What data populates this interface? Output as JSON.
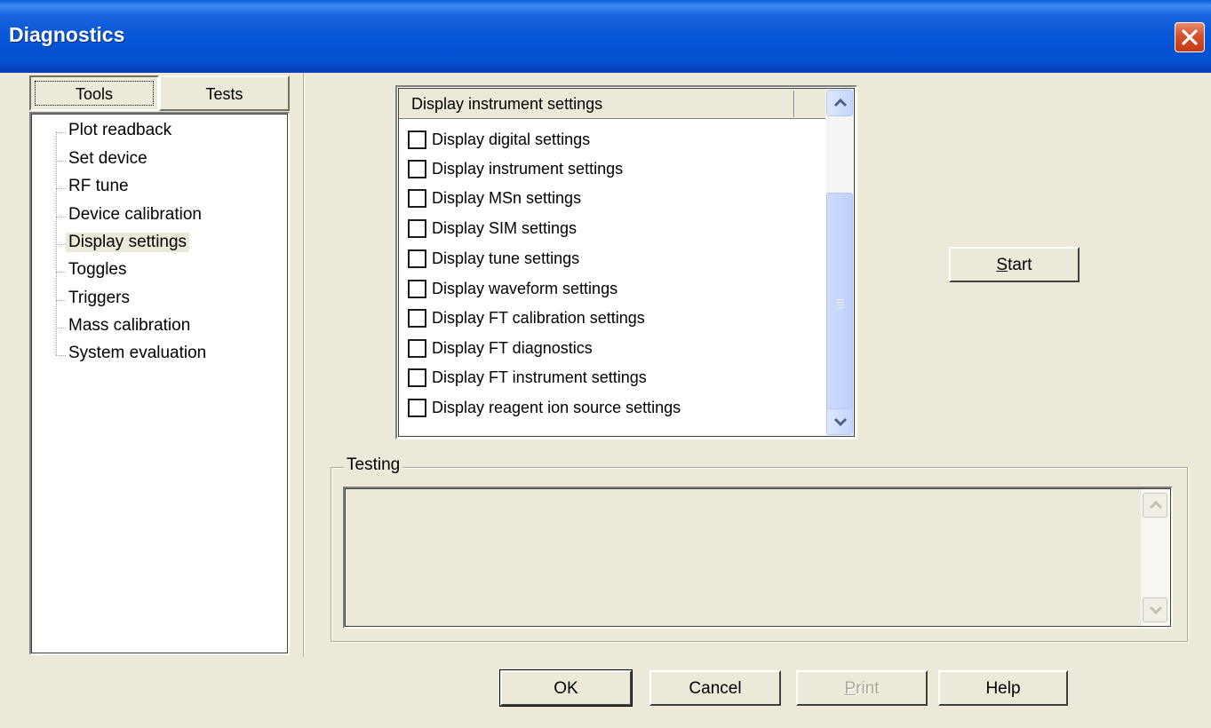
{
  "window": {
    "title": "Diagnostics"
  },
  "tabs": [
    {
      "label": "Tools",
      "active": true
    },
    {
      "label": "Tests",
      "active": false
    }
  ],
  "tree": {
    "items": [
      "Plot readback",
      "Set device",
      "RF tune",
      "Device calibration",
      "Display settings",
      "Toggles",
      "Triggers",
      "Mass calibration",
      "System evaluation"
    ],
    "selected": "Display settings"
  },
  "settings_list": {
    "header": "Display instrument settings",
    "items": [
      {
        "label": "Display digital settings",
        "checked": false
      },
      {
        "label": "Display instrument settings",
        "checked": false
      },
      {
        "label": "Display MSn settings",
        "checked": false
      },
      {
        "label": "Display SIM settings",
        "checked": false
      },
      {
        "label": "Display tune settings",
        "checked": false
      },
      {
        "label": "Display waveform settings",
        "checked": false
      },
      {
        "label": "Display FT calibration settings",
        "checked": false
      },
      {
        "label": "Display FT diagnostics",
        "checked": false
      },
      {
        "label": "Display FT instrument settings",
        "checked": false
      },
      {
        "label": "Display reagent ion source settings",
        "checked": false
      }
    ]
  },
  "start_button": {
    "label_mnemonic": "S",
    "label_rest": "tart"
  },
  "testing": {
    "label": "Testing",
    "text": ""
  },
  "footer": {
    "ok": "OK",
    "cancel": "Cancel",
    "print_mnemonic": "P",
    "print_rest": "rint",
    "help": "Help"
  },
  "colors": {
    "titlebar": "#0454d6",
    "dialog_bg": "#ece9d8",
    "close_button": "#d5502b",
    "scrollbar": "#c4d5fb"
  },
  "icons": [
    "close-icon",
    "chevron-up-icon",
    "chevron-down-icon"
  ]
}
